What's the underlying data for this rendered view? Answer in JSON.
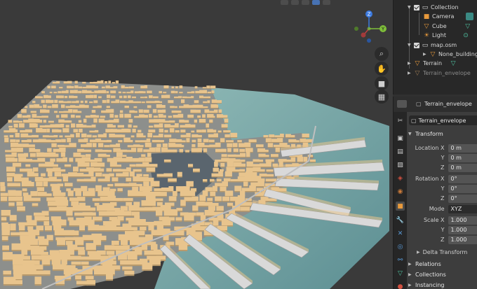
{
  "outliner": {
    "items": [
      {
        "label": "Collection",
        "icon": "collection-icon"
      },
      {
        "label": "Camera",
        "icon": "camera-icon"
      },
      {
        "label": "Cube",
        "icon": "mesh-icon"
      },
      {
        "label": "Light",
        "icon": "light-icon"
      },
      {
        "label": "map.osm",
        "icon": "collection-icon"
      },
      {
        "label": "None_buildings",
        "icon": "mesh-icon"
      },
      {
        "label": "Terrain",
        "icon": "mesh-icon"
      },
      {
        "label": "Terrain_envelope",
        "icon": "mesh-icon"
      }
    ]
  },
  "properties": {
    "header_object": "Terrain_envelope",
    "object_name": "Terrain_envelope",
    "transform": {
      "title": "Transform",
      "location": {
        "label_x": "Location X",
        "label_y": "Y",
        "label_z": "Z",
        "x": "0 m",
        "y": "0 m",
        "z": "0 m"
      },
      "rotation": {
        "label_x": "Rotation X",
        "label_y": "Y",
        "label_z": "Z",
        "x": "0°",
        "y": "0°",
        "z": "0°"
      },
      "mode": {
        "label": "Mode",
        "value": "XYZ Euler"
      },
      "scale": {
        "label_x": "Scale X",
        "label_y": "Y",
        "label_z": "Z",
        "x": "1.000",
        "y": "1.000",
        "z": "1.000"
      },
      "delta": "Delta Transform"
    },
    "panels": [
      "Relations",
      "Collections",
      "Instancing"
    ]
  },
  "gizmo": {
    "z": "Z",
    "y": "Y"
  },
  "colors": {
    "buildings": "#e8c48d",
    "water": "#6f9ea0",
    "viewport_bg": "#3a3a3a",
    "accent": "#4772b3"
  }
}
